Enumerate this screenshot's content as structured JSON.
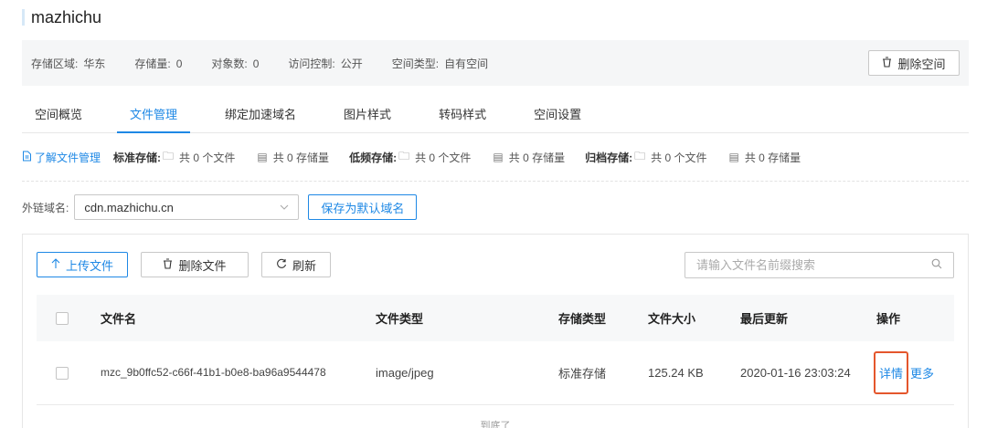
{
  "bucket": {
    "name": "mazhichu"
  },
  "info": {
    "region_label": "存储区域:",
    "region_value": "华东",
    "storage_label": "存储量:",
    "storage_value": "0",
    "objects_label": "对象数:",
    "objects_value": "0",
    "access_label": "访问控制:",
    "access_value": "公开",
    "space_type_label": "空间类型:",
    "space_type_value": "自有空间",
    "delete_bucket_label": "删除空间"
  },
  "tabs": [
    {
      "label": "空间概览"
    },
    {
      "label": "文件管理",
      "active": true
    },
    {
      "label": "绑定加速域名"
    },
    {
      "label": "图片样式"
    },
    {
      "label": "转码样式"
    },
    {
      "label": "空间设置"
    }
  ],
  "stats": {
    "learn_label": "了解文件管理",
    "standard_label": "标准存储:",
    "standard_files": "共 0 个文件",
    "standard_size": "共 0 存储量",
    "infrequent_label": "低频存储:",
    "infrequent_files": "共 0 个文件",
    "infrequent_size": "共 0 存储量",
    "archive_label": "归档存储:",
    "archive_files": "共 0 个文件",
    "archive_size": "共 0 存储量"
  },
  "domain": {
    "label": "外链域名:",
    "selected": "cdn.mazhichu.cn",
    "save_default_label": "保存为默认域名"
  },
  "toolbar": {
    "upload_label": "上传文件",
    "delete_label": "删除文件",
    "refresh_label": "刷新",
    "search_placeholder": "请输入文件名前缀搜索"
  },
  "table": {
    "headers": {
      "name": "文件名",
      "type": "文件类型",
      "storage": "存储类型",
      "size": "文件大小",
      "updated": "最后更新",
      "actions": "操作"
    },
    "rows": [
      {
        "name": "mzc_9b0ffc52-c66f-41b1-b0e8-ba96a9544478",
        "type": "image/jpeg",
        "storage": "标准存储",
        "size": "125.24 KB",
        "updated": "2020-01-16 23:03:24",
        "detail_label": "详情",
        "more_label": "更多"
      }
    ],
    "end_label": "到底了"
  },
  "colors": {
    "accent": "#1e88e5",
    "highlight": "#e4562c"
  }
}
